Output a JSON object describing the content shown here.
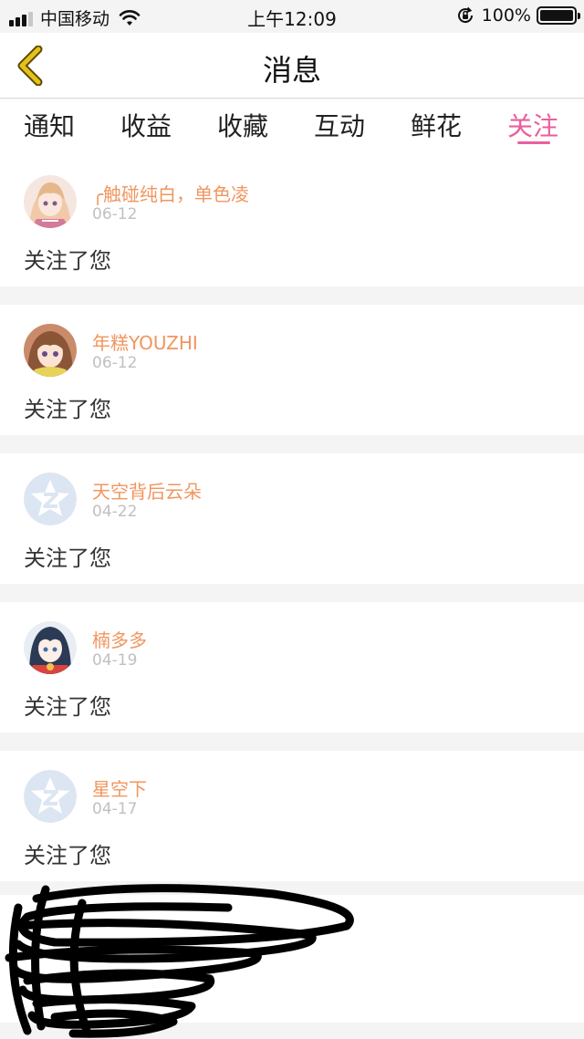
{
  "status_bar": {
    "carrier": "中国移动",
    "time": "上午12:09",
    "battery_percent": "100%",
    "battery_level": 1.0,
    "signal_bars": 3,
    "signal_bars_total": 4,
    "icons": [
      "signal-icon",
      "wifi-icon",
      "rotation-lock-icon",
      "battery-icon"
    ]
  },
  "nav": {
    "title": "消息",
    "back_icon": "chevron-left-icon",
    "back_icon_color": "#e6c11e"
  },
  "tabs": [
    {
      "label": "通知",
      "active": false
    },
    {
      "label": "收益",
      "active": false
    },
    {
      "label": "收藏",
      "active": false
    },
    {
      "label": "互动",
      "active": false
    },
    {
      "label": "鲜花",
      "active": false
    },
    {
      "label": "关注",
      "active": true
    }
  ],
  "colors": {
    "active_tab": "#ec5d9e",
    "username": "#f0965f",
    "date": "#c0c0c0",
    "background": "#f4f4f4",
    "default_avatar": "#dce6f2"
  },
  "messages": [
    {
      "username": "╭触碰纯白，单色凌",
      "date": "06-12",
      "text": "关注了您",
      "avatar": "anime-avatar"
    },
    {
      "username": "年糕YOUZHI",
      "date": "06-12",
      "text": "关注了您",
      "avatar": "anime-avatar"
    },
    {
      "username": "天空背后云朵",
      "date": "04-22",
      "text": "关注了您",
      "avatar": "default-qzone-avatar"
    },
    {
      "username": "楠多多",
      "date": "04-19",
      "text": "关注了您",
      "avatar": "anime-avatar"
    },
    {
      "username": "星空下",
      "date": "04-17",
      "text": "关注了您",
      "avatar": "default-qzone-avatar"
    }
  ]
}
